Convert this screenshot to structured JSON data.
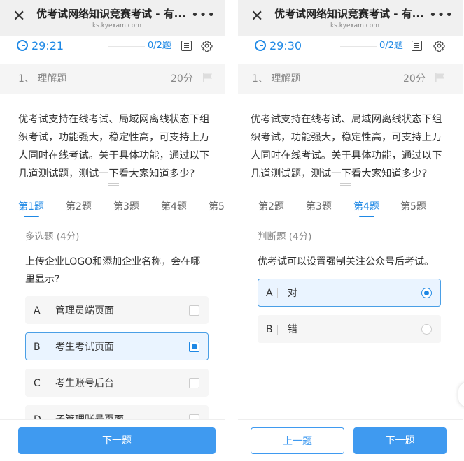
{
  "left": {
    "title": "优考试网络知识竞赛考试 - 有...",
    "domain": "ks.kyexam.com",
    "timer": "29:21",
    "progress": "0/2题",
    "section_title": "1、 理解题",
    "section_score": "20分",
    "intro": "优考试支持在线考试、局域网离线状态下组织考试，功能强大，稳定性高，可支持上万人同时在线考试。关于具体功能，通过以下几道测试题，测试一下看大家知道多少?",
    "tabs": [
      {
        "label": "第1题",
        "active": true
      },
      {
        "label": "第2题",
        "active": false
      },
      {
        "label": "第3题",
        "active": false
      },
      {
        "label": "第4题",
        "active": false
      },
      {
        "label": "第5",
        "active": false
      }
    ],
    "question_type": "多选题 (4分)",
    "question": "上传企业LOGO和添加企业名称，会在哪里显示?",
    "options": [
      {
        "letter": "A",
        "text": "管理员端页面",
        "selected": false
      },
      {
        "letter": "B",
        "text": "考生考试页面",
        "selected": true
      },
      {
        "letter": "C",
        "text": "考生账号后台",
        "selected": false
      },
      {
        "letter": "D",
        "text": "子管理账号页面",
        "selected": false
      }
    ],
    "next_button": "下一题"
  },
  "right": {
    "title": "优考试网络知识竞赛考试 - 有...",
    "domain": "ks.kyexam.com",
    "timer": "29:30",
    "progress": "0/2题",
    "section_title": "1、 理解题",
    "section_score": "20分",
    "intro": "优考试支持在线考试、局域网离线状态下组织考试，功能强大，稳定性高，可支持上万人同时在线考试。关于具体功能，通过以下几道测试题，测试一下看大家知道多少?",
    "tabs": [
      {
        "label": "第2题",
        "active": false
      },
      {
        "label": "第3题",
        "active": false
      },
      {
        "label": "第4题",
        "active": true
      },
      {
        "label": "第5题",
        "active": false
      }
    ],
    "question_type": "判断题 (4分)",
    "question": "优考试可以设置强制关注公众号后考试。",
    "options": [
      {
        "letter": "A",
        "text": "对",
        "selected": true
      },
      {
        "letter": "B",
        "text": "错",
        "selected": false
      }
    ],
    "prev_button": "上一题",
    "next_button": "下一题"
  },
  "icons": {
    "close": "close-icon",
    "more": "more-icon",
    "clock": "clock-icon",
    "answer_card": "answer-card-icon",
    "settings": "gear-icon",
    "flag": "flag-icon"
  },
  "colors": {
    "accent": "#1e88e5",
    "button": "#3f9af0",
    "header_bg": "#f0f0f0",
    "section_bg": "#f5f5f5"
  }
}
